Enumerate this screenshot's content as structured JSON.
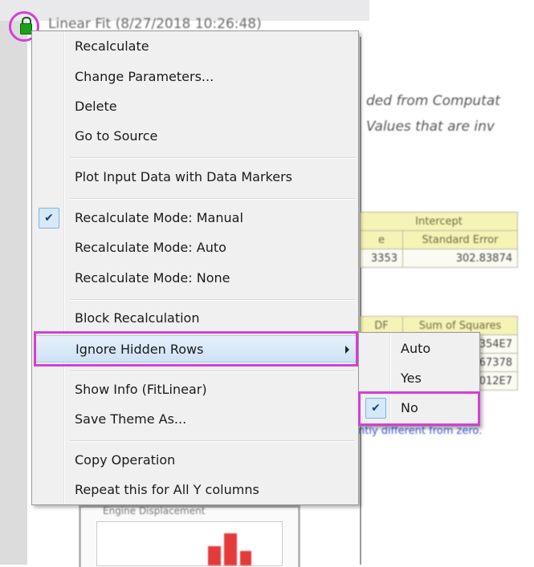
{
  "background": {
    "window_title": "Linear Fit (8/27/2018 10:26:48)",
    "note_line1": "ded from Computat",
    "note_line2": "Values that are inv",
    "table1": {
      "group_header": "Intercept",
      "col_a": "e",
      "col_b": "Standard Error",
      "val_a": "3353",
      "val_b": "302.83874"
    },
    "table2": {
      "col_a": "DF",
      "col_b": "Sum of Squares",
      "rows": [
        "354E7",
        "67378",
        "012E7"
      ]
    },
    "link_text": "ntly different from zero.",
    "graph_title": "Engine Displacement"
  },
  "context_menu": {
    "items": {
      "recalculate": "Recalculate",
      "change_parameters": "Change Parameters...",
      "delete": "Delete",
      "go_to_source": "Go to Source",
      "plot_input": "Plot Input Data with Data Markers",
      "mode_manual": "Recalculate Mode: Manual",
      "mode_auto": "Recalculate Mode: Auto",
      "mode_none": "Recalculate Mode: None",
      "block_recalc": "Block Recalculation",
      "ignore_hidden": "Ignore Hidden Rows",
      "show_info": "Show Info (FitLinear)",
      "save_theme": "Save Theme As...",
      "copy_operation": "Copy Operation",
      "repeat_all_y": "Repeat this for All Y columns"
    },
    "checked_item": "mode_manual",
    "highlighted_item": "ignore_hidden"
  },
  "submenu": {
    "items": {
      "auto": "Auto",
      "yes": "Yes",
      "no": "No"
    },
    "checked_item": "no"
  },
  "icons": {
    "lock": "lock-icon",
    "check": "checkmark-icon",
    "submenu_arrow": "chevron-right-icon"
  },
  "colors": {
    "highlight_outline": "#d43fd6",
    "lock_green": "#1aa31a",
    "menu_bg": "#f0f0f0",
    "hover_bg": "#d8e8f7"
  }
}
